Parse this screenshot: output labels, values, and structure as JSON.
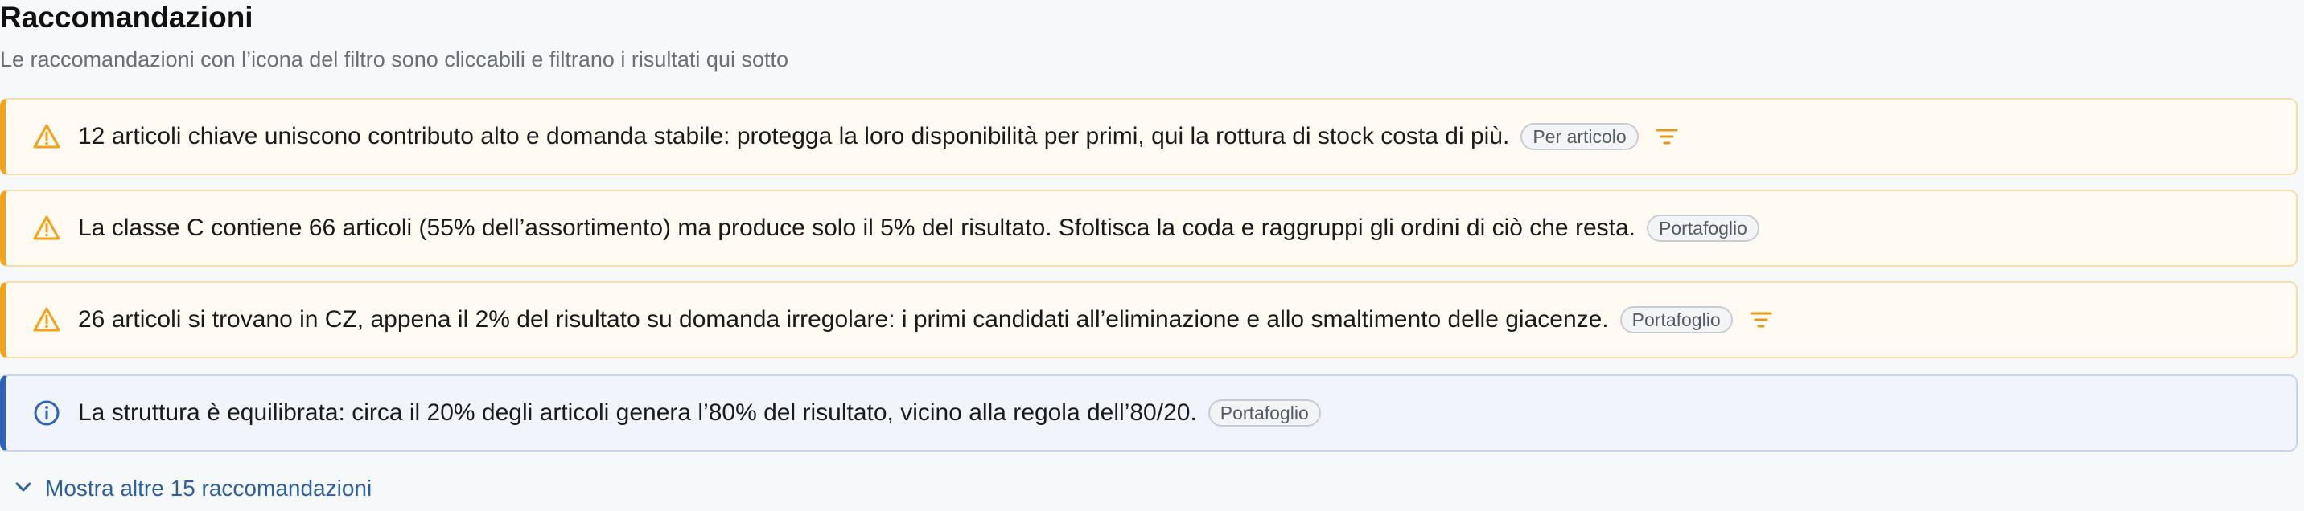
{
  "header": {
    "title": "Raccomandazioni",
    "subtitle": "Le raccomandazioni con l’icona del filtro sono cliccabili e filtrano i risultati qui sotto"
  },
  "recommendations": [
    {
      "severity": "warning",
      "icon": "warning-triangle-icon",
      "text": "12 articoli chiave uniscono contributo alto e domanda stabile: protegga la loro disponibilità per primi, qui la rottura di stock costa di più.",
      "badge": "Per articolo",
      "filterable": true
    },
    {
      "severity": "warning",
      "icon": "warning-triangle-icon",
      "text": "La classe C contiene 66 articoli (55% dell’assortimento) ma produce solo il 5% del risultato. Sfoltisca la coda e raggruppi gli ordini di ciò che resta.",
      "badge": "Portafoglio",
      "filterable": false
    },
    {
      "severity": "warning",
      "icon": "warning-triangle-icon",
      "text": "26 articoli si trovano in CZ, appena il 2% del risultato su domanda irregolare: i primi candidati all’eliminazione e allo smaltimento delle giacenze.",
      "badge": "Portafoglio",
      "filterable": true
    },
    {
      "severity": "info",
      "icon": "info-circle-icon",
      "text": "La struttura è equilibrata: circa il 20% degli articoli genera l’80% del risultato, vicino alla regola dell’80/20.",
      "badge": "Portafoglio",
      "filterable": false
    }
  ],
  "show_more": {
    "icon": "chevron-down-icon",
    "label": "Mostra altre 15 raccomandazioni"
  },
  "colors": {
    "warning_accent": "#f2a21b",
    "info_accent": "#2e63b8",
    "link": "#2b5f9e"
  }
}
